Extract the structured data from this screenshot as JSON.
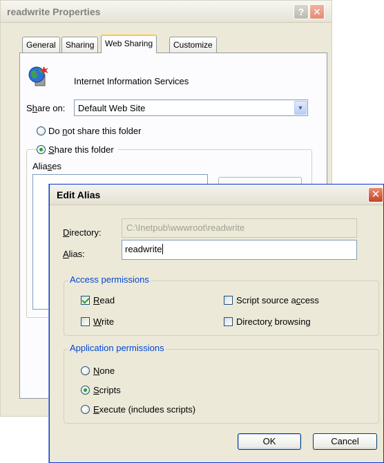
{
  "properties_window": {
    "title": "readwrite Properties",
    "help_glyph": "?",
    "close_glyph": "✕",
    "tabs": [
      {
        "label": "General"
      },
      {
        "label": "Sharing"
      },
      {
        "label": "Web Sharing",
        "active": true
      },
      {
        "label": "Customize"
      }
    ],
    "service_label": "Internet Information Services",
    "share_on": {
      "label_pre": "S",
      "label_ul": "h",
      "label_post": "are on:",
      "value": "Default Web Site"
    },
    "radio_not_share": {
      "pre": "Do ",
      "ul": "n",
      "post": "ot share this folder",
      "selected": false
    },
    "radio_share": {
      "pre": "",
      "ul": "S",
      "post": "hare this folder",
      "selected": true
    },
    "aliases_label": {
      "pre": "Alia",
      "ul": "s",
      "post": "es"
    }
  },
  "edit_alias": {
    "title": "Edit Alias",
    "close_glyph": "✕",
    "directory": {
      "label_ul": "D",
      "label_post": "irectory:",
      "value": "C:\\Inetpub\\wwwroot\\readwrite"
    },
    "alias": {
      "label_ul": "A",
      "label_post": "lias:",
      "value": "readwrite"
    },
    "access_permissions": {
      "title": "Access permissions",
      "read": {
        "ul": "R",
        "post": "ead",
        "checked": true
      },
      "write": {
        "ul": "W",
        "post": "rite",
        "checked": false
      },
      "script_source": {
        "pre": "Script source a",
        "ul": "c",
        "post": "cess",
        "checked": false
      },
      "directory_browsing": {
        "pre": "Director",
        "ul": "y",
        "post": " browsing",
        "checked": false
      }
    },
    "application_permissions": {
      "title": "Application permissions",
      "none": {
        "ul": "N",
        "post": "one",
        "selected": false
      },
      "scripts": {
        "ul": "S",
        "post": "cripts",
        "selected": true
      },
      "execute": {
        "ul": "E",
        "post": "xecute (includes scripts)",
        "selected": false
      }
    },
    "ok_label": "OK",
    "cancel_label": "Cancel"
  },
  "colors": {
    "dialog_face": "#ece9d8",
    "group_title": "#0046d5",
    "radio_dot": "#21a121",
    "close_button": "#c4432a"
  }
}
